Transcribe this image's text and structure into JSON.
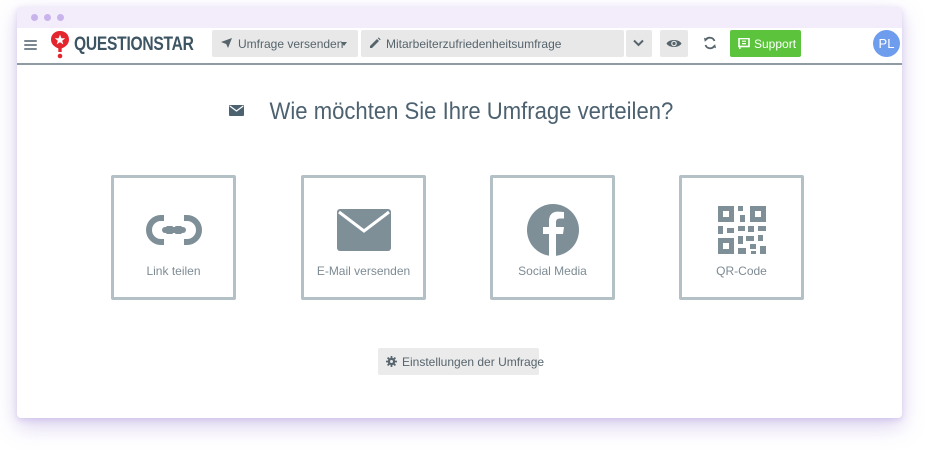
{
  "app": {
    "brand": "QUESTIONSTAR"
  },
  "toolbar": {
    "send_dropdown": "Umfrage versenden",
    "survey_title": "Mitarbeiterzufriedenheitsumfrage",
    "support_label": "Support",
    "avatar_initials": "PL"
  },
  "main": {
    "heading": "Wie möchten Sie Ihre Umfrage verteilen?",
    "options": [
      {
        "label": "Link teilen",
        "icon": "link-icon"
      },
      {
        "label": "E-Mail versenden",
        "icon": "envelope-icon"
      },
      {
        "label": "Social Media",
        "icon": "facebook-icon"
      },
      {
        "label": "QR-Code",
        "icon": "qr-code-icon"
      }
    ],
    "settings_button": "Einstellungen der Umfrage"
  },
  "colors": {
    "accent_green": "#5cc43c",
    "avatar_blue": "#6f9ded",
    "brand_red": "#e3262e",
    "icon_gray": "#7e8f98",
    "card_border": "#b3c0c6",
    "window_dots": "#c8b3ec"
  }
}
